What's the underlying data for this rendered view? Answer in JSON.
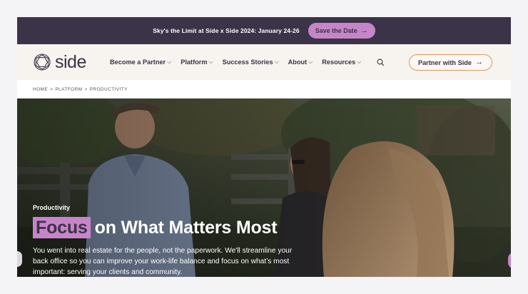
{
  "colors": {
    "brand_dark": "#3b3347",
    "accent_pink": "#c785c9",
    "partner_border": "#d59a5c",
    "nav_bg": "#f7f3ef"
  },
  "announcement": {
    "text": "Sky's the Limit at Side x Side 2024: January 24-26",
    "button_label": "Save the Date",
    "button_icon": "arrow-right-icon"
  },
  "nav": {
    "logo_text": "side",
    "logo_icon": "side-logo-icon",
    "menu": [
      {
        "label": "Become a Partner"
      },
      {
        "label": "Platform"
      },
      {
        "label": "Success Stories"
      },
      {
        "label": "About"
      },
      {
        "label": "Resources"
      }
    ],
    "search_icon": "search-icon",
    "cta_label": "Partner with Side",
    "cta_icon": "arrow-right-icon"
  },
  "breadcrumb": {
    "items": [
      "HOME",
      "PLATFORM",
      "PRODUCTIVITY"
    ],
    "separator": ">"
  },
  "hero": {
    "eyebrow": "Productivity",
    "title_highlight": "Focus",
    "title_rest": "on What Matters Most",
    "description": "You went into real estate for the people, not the paperwork. We'll streamline your back office so you can improve your work-life balance and focus on what’s most important: serving your clients and community."
  }
}
